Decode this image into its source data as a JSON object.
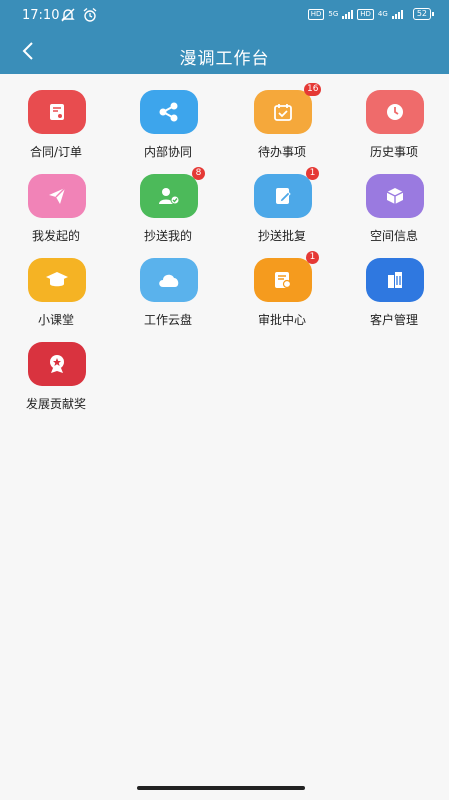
{
  "status_bar": {
    "time": "17:10",
    "net1": "HD",
    "gen1": "5G",
    "net2": "HD",
    "gen2": "4G",
    "battery": "52"
  },
  "header": {
    "title": "漫调工作台",
    "background": "#3a8eb9"
  },
  "apps": [
    {
      "label": "合同/订单",
      "color": "#e84c4f",
      "icon": "contract-icon",
      "badge": ""
    },
    {
      "label": "内部协同",
      "color": "#3da5ec",
      "icon": "share-icon",
      "badge": ""
    },
    {
      "label": "待办事项",
      "color": "#f5a83b",
      "icon": "calendar-check-icon",
      "badge": "16"
    },
    {
      "label": "历史事项",
      "color": "#ef6b6b",
      "icon": "clock-icon",
      "badge": ""
    },
    {
      "label": "我发起的",
      "color": "#f183b7",
      "icon": "paper-plane-icon",
      "badge": ""
    },
    {
      "label": "抄送我的",
      "color": "#4cba5a",
      "icon": "user-check-icon",
      "badge": "8"
    },
    {
      "label": "抄送批复",
      "color": "#4ca8e8",
      "icon": "note-edit-icon",
      "badge": "1"
    },
    {
      "label": "空间信息",
      "color": "#9a7ae0",
      "icon": "cube-icon",
      "badge": ""
    },
    {
      "label": "小课堂",
      "color": "#f5b324",
      "icon": "graduation-cap-icon",
      "badge": ""
    },
    {
      "label": "工作云盘",
      "color": "#5ab2ec",
      "icon": "cloud-icon",
      "badge": ""
    },
    {
      "label": "审批中心",
      "color": "#f59b1e",
      "icon": "approval-doc-icon",
      "badge": "1"
    },
    {
      "label": "客户管理",
      "color": "#2f78e0",
      "icon": "building-icon",
      "badge": ""
    },
    {
      "label": "发展贡献奖",
      "color": "#d9333f",
      "icon": "award-medal-icon",
      "badge": ""
    }
  ]
}
